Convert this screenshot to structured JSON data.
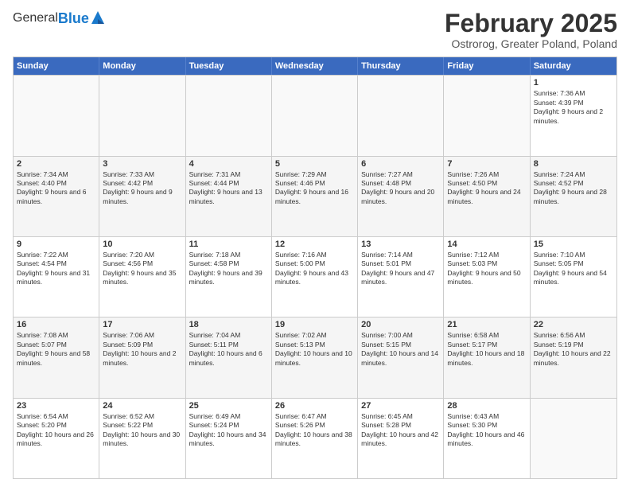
{
  "logo": {
    "general": "General",
    "blue": "Blue"
  },
  "title": "February 2025",
  "subtitle": "Ostrorog, Greater Poland, Poland",
  "headers": [
    "Sunday",
    "Monday",
    "Tuesday",
    "Wednesday",
    "Thursday",
    "Friday",
    "Saturday"
  ],
  "rows": [
    [
      {
        "day": "",
        "info": ""
      },
      {
        "day": "",
        "info": ""
      },
      {
        "day": "",
        "info": ""
      },
      {
        "day": "",
        "info": ""
      },
      {
        "day": "",
        "info": ""
      },
      {
        "day": "",
        "info": ""
      },
      {
        "day": "1",
        "info": "Sunrise: 7:36 AM\nSunset: 4:39 PM\nDaylight: 9 hours and 2 minutes."
      }
    ],
    [
      {
        "day": "2",
        "info": "Sunrise: 7:34 AM\nSunset: 4:40 PM\nDaylight: 9 hours and 6 minutes."
      },
      {
        "day": "3",
        "info": "Sunrise: 7:33 AM\nSunset: 4:42 PM\nDaylight: 9 hours and 9 minutes."
      },
      {
        "day": "4",
        "info": "Sunrise: 7:31 AM\nSunset: 4:44 PM\nDaylight: 9 hours and 13 minutes."
      },
      {
        "day": "5",
        "info": "Sunrise: 7:29 AM\nSunset: 4:46 PM\nDaylight: 9 hours and 16 minutes."
      },
      {
        "day": "6",
        "info": "Sunrise: 7:27 AM\nSunset: 4:48 PM\nDaylight: 9 hours and 20 minutes."
      },
      {
        "day": "7",
        "info": "Sunrise: 7:26 AM\nSunset: 4:50 PM\nDaylight: 9 hours and 24 minutes."
      },
      {
        "day": "8",
        "info": "Sunrise: 7:24 AM\nSunset: 4:52 PM\nDaylight: 9 hours and 28 minutes."
      }
    ],
    [
      {
        "day": "9",
        "info": "Sunrise: 7:22 AM\nSunset: 4:54 PM\nDaylight: 9 hours and 31 minutes."
      },
      {
        "day": "10",
        "info": "Sunrise: 7:20 AM\nSunset: 4:56 PM\nDaylight: 9 hours and 35 minutes."
      },
      {
        "day": "11",
        "info": "Sunrise: 7:18 AM\nSunset: 4:58 PM\nDaylight: 9 hours and 39 minutes."
      },
      {
        "day": "12",
        "info": "Sunrise: 7:16 AM\nSunset: 5:00 PM\nDaylight: 9 hours and 43 minutes."
      },
      {
        "day": "13",
        "info": "Sunrise: 7:14 AM\nSunset: 5:01 PM\nDaylight: 9 hours and 47 minutes."
      },
      {
        "day": "14",
        "info": "Sunrise: 7:12 AM\nSunset: 5:03 PM\nDaylight: 9 hours and 50 minutes."
      },
      {
        "day": "15",
        "info": "Sunrise: 7:10 AM\nSunset: 5:05 PM\nDaylight: 9 hours and 54 minutes."
      }
    ],
    [
      {
        "day": "16",
        "info": "Sunrise: 7:08 AM\nSunset: 5:07 PM\nDaylight: 9 hours and 58 minutes."
      },
      {
        "day": "17",
        "info": "Sunrise: 7:06 AM\nSunset: 5:09 PM\nDaylight: 10 hours and 2 minutes."
      },
      {
        "day": "18",
        "info": "Sunrise: 7:04 AM\nSunset: 5:11 PM\nDaylight: 10 hours and 6 minutes."
      },
      {
        "day": "19",
        "info": "Sunrise: 7:02 AM\nSunset: 5:13 PM\nDaylight: 10 hours and 10 minutes."
      },
      {
        "day": "20",
        "info": "Sunrise: 7:00 AM\nSunset: 5:15 PM\nDaylight: 10 hours and 14 minutes."
      },
      {
        "day": "21",
        "info": "Sunrise: 6:58 AM\nSunset: 5:17 PM\nDaylight: 10 hours and 18 minutes."
      },
      {
        "day": "22",
        "info": "Sunrise: 6:56 AM\nSunset: 5:19 PM\nDaylight: 10 hours and 22 minutes."
      }
    ],
    [
      {
        "day": "23",
        "info": "Sunrise: 6:54 AM\nSunset: 5:20 PM\nDaylight: 10 hours and 26 minutes."
      },
      {
        "day": "24",
        "info": "Sunrise: 6:52 AM\nSunset: 5:22 PM\nDaylight: 10 hours and 30 minutes."
      },
      {
        "day": "25",
        "info": "Sunrise: 6:49 AM\nSunset: 5:24 PM\nDaylight: 10 hours and 34 minutes."
      },
      {
        "day": "26",
        "info": "Sunrise: 6:47 AM\nSunset: 5:26 PM\nDaylight: 10 hours and 38 minutes."
      },
      {
        "day": "27",
        "info": "Sunrise: 6:45 AM\nSunset: 5:28 PM\nDaylight: 10 hours and 42 minutes."
      },
      {
        "day": "28",
        "info": "Sunrise: 6:43 AM\nSunset: 5:30 PM\nDaylight: 10 hours and 46 minutes."
      },
      {
        "day": "",
        "info": ""
      }
    ]
  ]
}
